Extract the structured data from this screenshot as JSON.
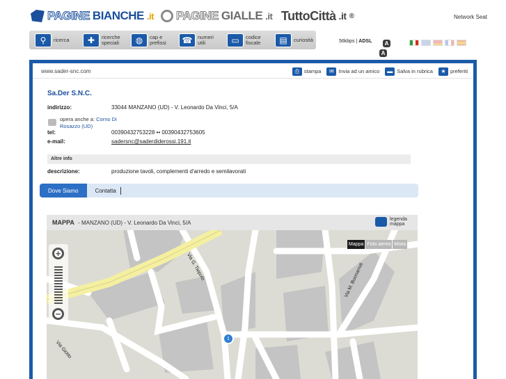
{
  "header": {
    "pb_prefix": "PAGINE",
    "pb_suffix": "BIANCHE",
    "pb_dot": ".it",
    "pg_prefix": "PAGINE",
    "pg_suffix": "GIALLE",
    "pg_dot": ".it",
    "tc_name": "TuttoCittà",
    "tc_dot": ".it",
    "network": "Network Seat"
  },
  "nav": [
    {
      "icon": "magnifier-icon",
      "label": "ricerca"
    },
    {
      "icon": "puzzle-icon",
      "label": "ricerche speciali"
    },
    {
      "icon": "globe-icon",
      "label": "cap e prefissi"
    },
    {
      "icon": "phone-icon",
      "label": "numeri utili"
    },
    {
      "icon": "card-icon",
      "label": "codice fiscale"
    },
    {
      "icon": "book-icon",
      "label": "curiosità"
    }
  ],
  "speed": {
    "kbps": "56kbps",
    "adsl": "ADSL",
    "badge": "A"
  },
  "url": "www.sader-snc.com",
  "actions": [
    "stampa",
    "Invia ad un amico",
    "Salva in rubrica",
    "preferiti"
  ],
  "company": {
    "name": "Sa.Der S.N.C.",
    "address_label": "indirizzo:",
    "address": "33044 MANZANO (UD) - V. Leonardo Da Vinci, 5/A",
    "also_prefix": "opera anche a:",
    "also_link": "Corno Di Rosazzo (UD)",
    "tel_label": "tel:",
    "tel": "00390432753228 •• 00390432753605",
    "email_label": "e-mail:",
    "email": "sadersnc@saderdiderossi.191.it",
    "section": "Altre info",
    "desc_label": "descrizione:",
    "desc": "produzione tavoli, complementi d'arredo e semilavorati"
  },
  "tabs": [
    "Dove Siamo",
    "Contatta"
  ],
  "map": {
    "title": "MAPPA",
    "subtitle": "MANZANO (UD) - V. Leonardo Da Vinci, 5/A",
    "legend": "legenda mappa",
    "types": [
      "Mappa",
      "Foto aerea",
      "Mista"
    ],
    "streets": [
      "Via G. Tiepolo",
      "Via M. Buonarroti",
      "Via Giotto"
    ],
    "marker": "1",
    "zoom_in": "+",
    "zoom_out": "−"
  },
  "colors": {
    "brand_blue": "#1b5aa8",
    "road_yellow": "#f5f0a0"
  }
}
